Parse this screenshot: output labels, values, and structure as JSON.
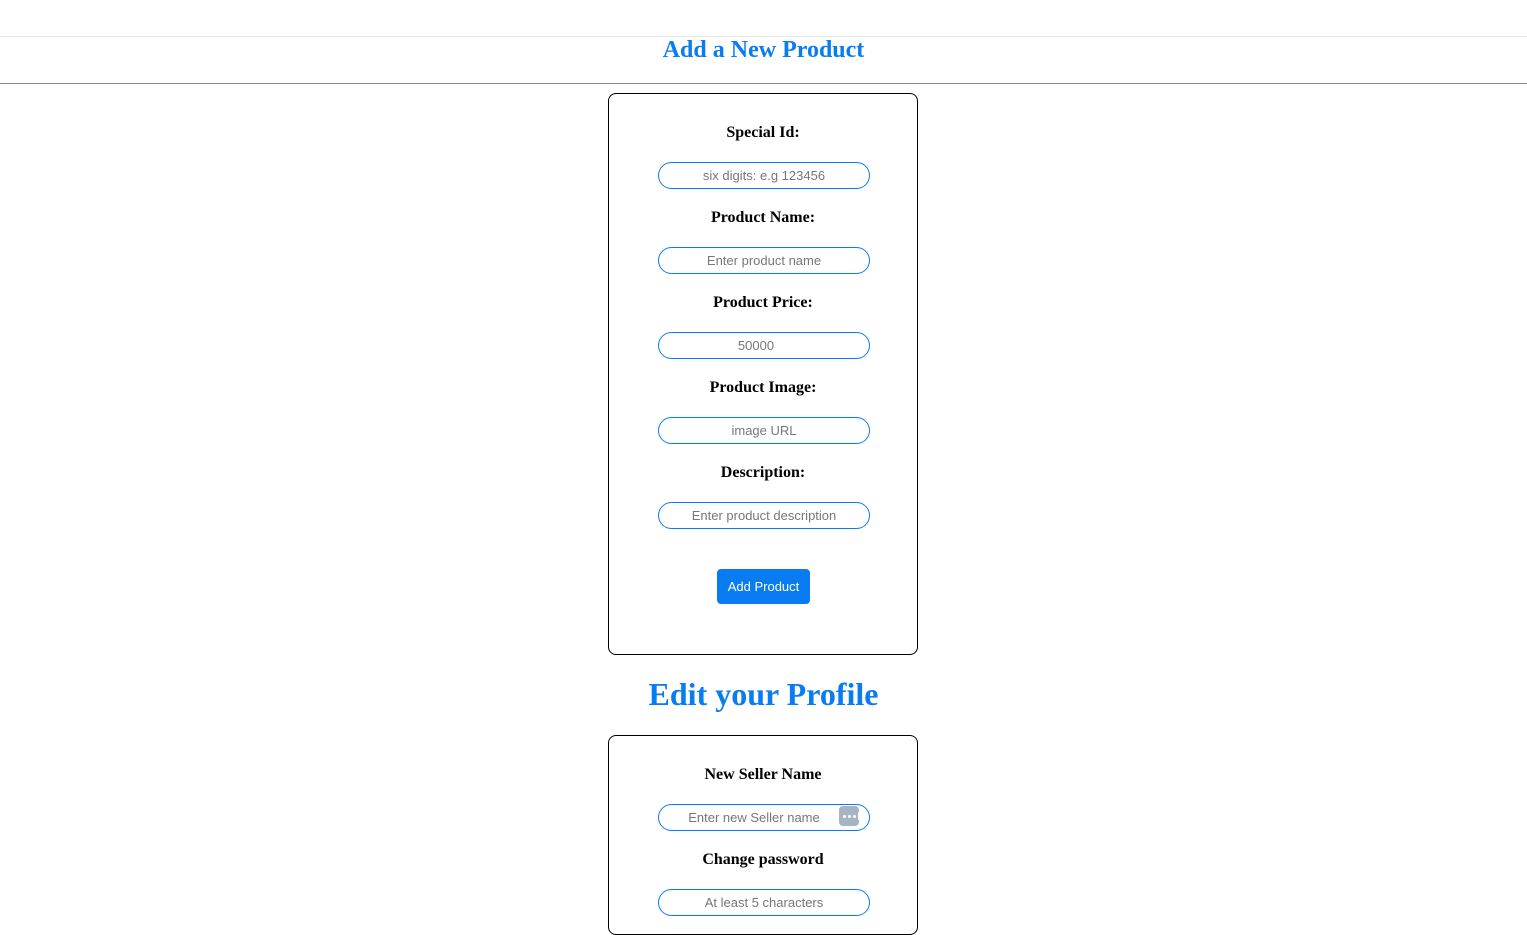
{
  "header": {
    "title": "Add a New Product"
  },
  "product_form": {
    "special_id": {
      "label": "Special Id:",
      "placeholder": "six digits: e.g 123456"
    },
    "product_name": {
      "label": "Product Name:",
      "placeholder": "Enter product name"
    },
    "product_price": {
      "label": "Product Price:",
      "placeholder": "50000"
    },
    "product_image": {
      "label": "Product Image:",
      "placeholder": "image URL"
    },
    "description": {
      "label": "Description:",
      "placeholder": "Enter product description"
    },
    "submit_label": "Add Product"
  },
  "profile": {
    "title": "Edit your Profile",
    "seller_name": {
      "label": "New Seller Name",
      "placeholder": "Enter new Seller name",
      "icon": "password-manager-dots-icon"
    },
    "password": {
      "label": "Change password",
      "placeholder": "At least 5 characters"
    }
  },
  "colors": {
    "accent": "#0a7cf2",
    "card_border": "#000000",
    "button_text": "#ffffff"
  }
}
